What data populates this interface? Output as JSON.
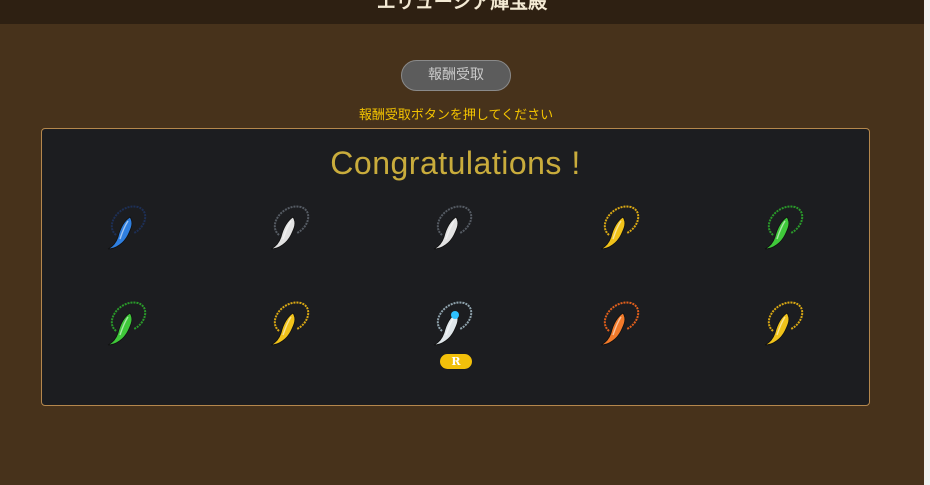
{
  "header": {
    "title": "エリューシア輝宝殿"
  },
  "claim_button": {
    "label": "報酬受取"
  },
  "hint": {
    "text": "報酬受取ボタンを押してください"
  },
  "result": {
    "title": "Congratulations !",
    "items": [
      {
        "name": "claw-necklace-blue-icon",
        "color": "#2f7fe0",
        "cord": "#1d2f55"
      },
      {
        "name": "claw-necklace-silver-icon",
        "color": "#e2e2e2",
        "cord": "#555b63"
      },
      {
        "name": "claw-necklace-silver-icon",
        "color": "#e2e2e2",
        "cord": "#555b63"
      },
      {
        "name": "claw-necklace-gold-icon",
        "color": "#f0c21a",
        "cord": "#d9a814"
      },
      {
        "name": "claw-necklace-green-icon",
        "color": "#3fc83a",
        "cord": "#2a9a2a"
      },
      {
        "name": "claw-necklace-green-icon",
        "color": "#3fc83a",
        "cord": "#2a9a2a"
      },
      {
        "name": "claw-necklace-gold-icon",
        "color": "#f0c21a",
        "cord": "#d9a814"
      },
      {
        "name": "claw-necklace-rare-icon",
        "color": "#dfe6ea",
        "cord": "#8fa3ad",
        "gem": "#2ec1ff",
        "badge": "R"
      },
      {
        "name": "claw-necklace-orange-icon",
        "color": "#f27a2a",
        "cord": "#e05f1c"
      },
      {
        "name": "claw-necklace-gold-icon",
        "color": "#f0c21a",
        "cord": "#d9a814"
      }
    ]
  }
}
